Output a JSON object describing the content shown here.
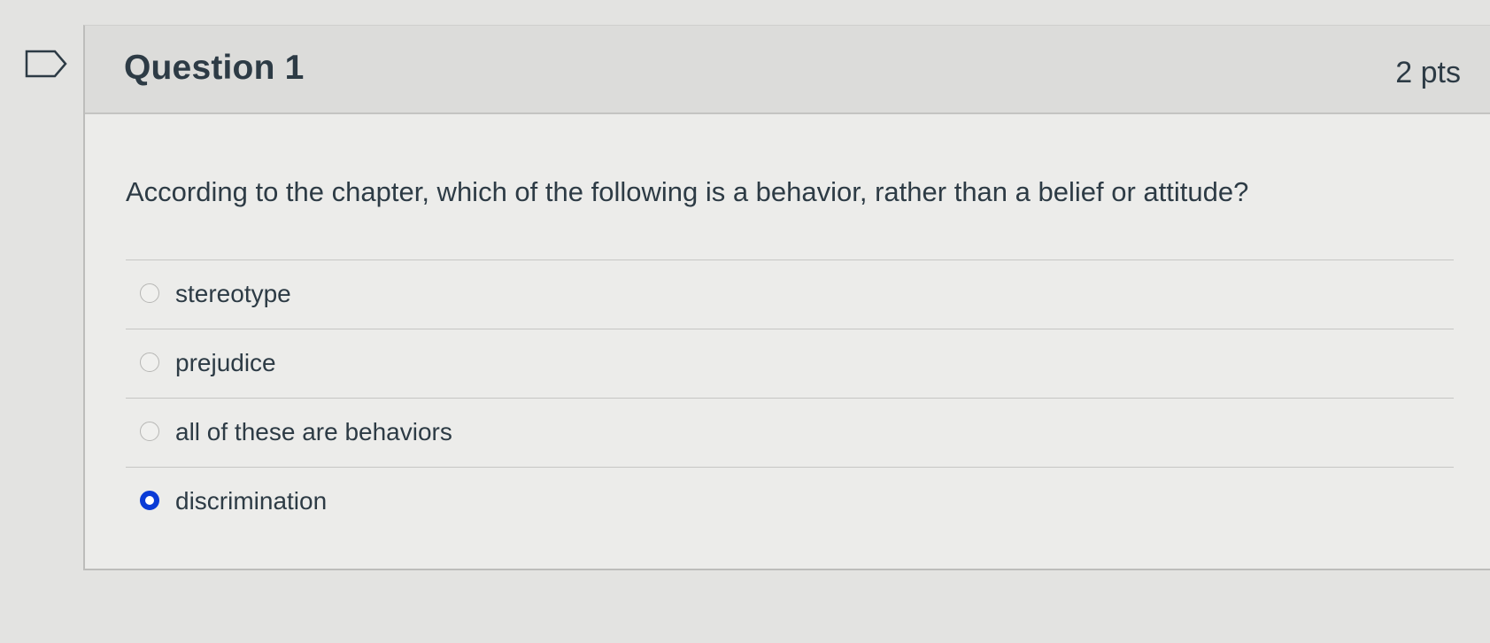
{
  "question": {
    "title": "Question 1",
    "points": "2 pts",
    "text": "According to the chapter, which of the following is a behavior, rather than a belief or attitude?"
  },
  "answers": [
    {
      "label": "stereotype",
      "selected": false
    },
    {
      "label": "prejudice",
      "selected": false
    },
    {
      "label": "all of these are behaviors",
      "selected": false
    },
    {
      "label": "discrimination",
      "selected": true
    }
  ],
  "icons": {
    "flag": "bookmark-flag-icon"
  },
  "colors": {
    "selected_radio": "#0a3bd6",
    "text": "#2d3b45",
    "header_bg": "#dcdcda"
  }
}
